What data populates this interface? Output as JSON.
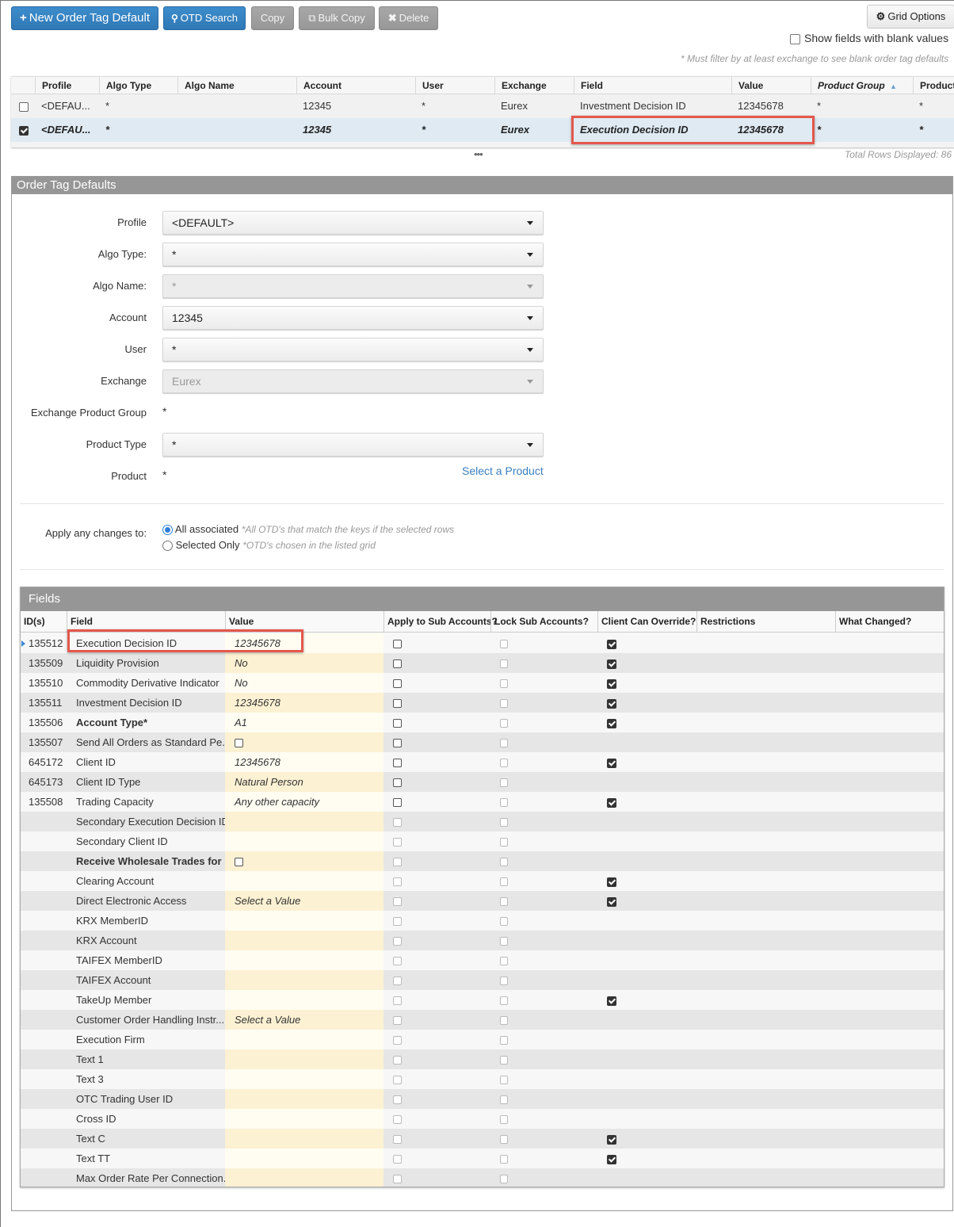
{
  "toolbar": {
    "new_label": "New Order Tag Default",
    "search_label": "OTD Search",
    "copy_label": "Copy",
    "bulk_copy_label": "Bulk Copy",
    "delete_label": "Delete",
    "grid_options_label": "Grid Options",
    "show_blank_label": "Show fields with blank values",
    "filter_note": "* Must filter by at least exchange to see blank order tag defaults"
  },
  "top_grid": {
    "columns": [
      "Profile",
      "Algo Type",
      "Algo Name",
      "Account",
      "User",
      "Exchange",
      "Field",
      "Value",
      "Product Group",
      "Product"
    ],
    "sorted_column": "Product Group",
    "sort_direction": "ascending",
    "rows": [
      {
        "selected": false,
        "profile": "<DEFAU...",
        "algo_type": "*",
        "algo_name": "",
        "account": "12345",
        "user": "*",
        "exchange": "Eurex",
        "field": "Investment Decision ID",
        "value": "12345678",
        "product_group": "*",
        "product": "*"
      },
      {
        "selected": true,
        "profile": "<DEFAU...",
        "algo_type": "*",
        "algo_name": "",
        "account": "12345",
        "user": "*",
        "exchange": "Eurex",
        "field": "Execution Decision ID",
        "value": "12345678",
        "product_group": "*",
        "product": "*"
      }
    ],
    "more_label": "•••",
    "total_rows": "Total Rows Displayed: 86"
  },
  "panel": {
    "title": "Order Tag Defaults",
    "form": {
      "profile": {
        "label": "Profile",
        "value": "<DEFAULT>"
      },
      "algo_type": {
        "label": "Algo Type:",
        "value": "*"
      },
      "algo_name": {
        "label": "Algo Name:",
        "value": "*"
      },
      "account": {
        "label": "Account",
        "value": "12345"
      },
      "user": {
        "label": "User",
        "value": "*"
      },
      "exchange": {
        "label": "Exchange",
        "value": "Eurex"
      },
      "exchange_product_group": {
        "label": "Exchange Product Group",
        "value": "*"
      },
      "product_type": {
        "label": "Product Type",
        "value": "*"
      },
      "product": {
        "label": "Product",
        "value": "*",
        "link": "Select a Product"
      }
    },
    "apply": {
      "label": "Apply any changes to:",
      "options": [
        {
          "label": "All associated",
          "hint": "*All OTD's that match the keys if the selected rows",
          "selected": true
        },
        {
          "label": "Selected Only",
          "hint": "*OTD's chosen in the listed grid",
          "selected": false
        }
      ]
    }
  },
  "fields": {
    "title": "Fields",
    "columns": [
      "ID(s)",
      "Field",
      "Value",
      "Apply to Sub Accounts?",
      "Lock Sub Accounts?",
      "Client Can Override?",
      "Restrictions",
      "What Changed?"
    ],
    "rows": [
      {
        "id": "135512",
        "field": "Execution Decision ID",
        "value": "12345678",
        "bold": false,
        "apply": false,
        "apply_enabled": true,
        "lock": false,
        "override": true,
        "current": true
      },
      {
        "id": "135509",
        "field": "Liquidity Provision",
        "value": "No",
        "bold": false,
        "apply": false,
        "apply_enabled": true,
        "lock": false,
        "override": true
      },
      {
        "id": "135510",
        "field": "Commodity Derivative Indicator",
        "value": "No",
        "bold": false,
        "apply": false,
        "apply_enabled": true,
        "lock": false,
        "override": true
      },
      {
        "id": "135511",
        "field": "Investment Decision ID",
        "value": "12345678",
        "bold": false,
        "apply": false,
        "apply_enabled": true,
        "lock": false,
        "override": true
      },
      {
        "id": "135506",
        "field": "Account Type*",
        "value": "A1",
        "bold": true,
        "apply": false,
        "apply_enabled": true,
        "lock": false,
        "override": true
      },
      {
        "id": "135507",
        "field": "Send All Orders as Standard Pe...",
        "value_checkbox": false,
        "bold": false,
        "apply": false,
        "apply_enabled": true,
        "lock": false,
        "override": false
      },
      {
        "id": "645172",
        "field": "Client ID",
        "value": "12345678",
        "bold": false,
        "apply": false,
        "apply_enabled": true,
        "lock": false,
        "override": true
      },
      {
        "id": "645173",
        "field": "Client ID Type",
        "value": "Natural Person",
        "bold": false,
        "apply": false,
        "apply_enabled": true,
        "lock": false,
        "override": false
      },
      {
        "id": "135508",
        "field": "Trading Capacity",
        "value": "Any other capacity",
        "bold": false,
        "apply": false,
        "apply_enabled": true,
        "lock": false,
        "override": true
      },
      {
        "id": "",
        "field": "Secondary Execution Decision ID",
        "value": "",
        "bold": false,
        "apply": false,
        "apply_enabled": false,
        "lock": false,
        "override": false
      },
      {
        "id": "",
        "field": "Secondary Client ID",
        "value": "",
        "bold": false,
        "apply": false,
        "apply_enabled": false,
        "lock": false,
        "override": false
      },
      {
        "id": "",
        "field": "Receive Wholesale Trades for ...",
        "value_checkbox": false,
        "bold": true,
        "apply": false,
        "apply_enabled": false,
        "lock": false,
        "override": false
      },
      {
        "id": "",
        "field": "Clearing Account",
        "value": "",
        "bold": false,
        "apply": false,
        "apply_enabled": false,
        "lock": false,
        "override": true
      },
      {
        "id": "",
        "field": "Direct Electronic Access",
        "value": "Select a Value",
        "bold": false,
        "apply": false,
        "apply_enabled": false,
        "lock": false,
        "override": true
      },
      {
        "id": "",
        "field": "KRX MemberID",
        "value": "",
        "bold": false,
        "apply": false,
        "apply_enabled": false,
        "lock": false,
        "override": false
      },
      {
        "id": "",
        "field": "KRX Account",
        "value": "",
        "bold": false,
        "apply": false,
        "apply_enabled": false,
        "lock": false,
        "override": false
      },
      {
        "id": "",
        "field": "TAIFEX MemberID",
        "value": "",
        "bold": false,
        "apply": false,
        "apply_enabled": false,
        "lock": false,
        "override": false
      },
      {
        "id": "",
        "field": "TAIFEX Account",
        "value": "",
        "bold": false,
        "apply": false,
        "apply_enabled": false,
        "lock": false,
        "override": false
      },
      {
        "id": "",
        "field": "TakeUp Member",
        "value": "",
        "bold": false,
        "apply": false,
        "apply_enabled": false,
        "lock": false,
        "override": true
      },
      {
        "id": "",
        "field": "Customer Order Handling Instr...",
        "value": "Select a Value",
        "bold": false,
        "apply": false,
        "apply_enabled": false,
        "lock": false,
        "override": false
      },
      {
        "id": "",
        "field": "Execution Firm",
        "value": "",
        "bold": false,
        "apply": false,
        "apply_enabled": false,
        "lock": false,
        "override": false
      },
      {
        "id": "",
        "field": "Text 1",
        "value": "",
        "bold": false,
        "apply": false,
        "apply_enabled": false,
        "lock": false,
        "override": false
      },
      {
        "id": "",
        "field": "Text 3",
        "value": "",
        "bold": false,
        "apply": false,
        "apply_enabled": false,
        "lock": false,
        "override": false
      },
      {
        "id": "",
        "field": "OTC Trading User ID",
        "value": "",
        "bold": false,
        "apply": false,
        "apply_enabled": false,
        "lock": false,
        "override": false
      },
      {
        "id": "",
        "field": "Cross ID",
        "value": "",
        "bold": false,
        "apply": false,
        "apply_enabled": false,
        "lock": false,
        "override": false
      },
      {
        "id": "",
        "field": "Text C",
        "value": "",
        "bold": false,
        "apply": false,
        "apply_enabled": false,
        "lock": false,
        "override": true
      },
      {
        "id": "",
        "field": "Text TT",
        "value": "",
        "bold": false,
        "apply": false,
        "apply_enabled": false,
        "lock": false,
        "override": true
      },
      {
        "id": "",
        "field": "Max Order Rate Per Connection...",
        "value": "",
        "bold": false,
        "apply": false,
        "apply_enabled": false,
        "lock": false,
        "override": false
      }
    ]
  },
  "colors": {
    "primary_button": "#2f78b5",
    "secondary_button": "#979797",
    "highlight_box": "#e4574c",
    "selected_row": "#dfeaf2",
    "panel_header": "#969696",
    "link": "#3a7fc1",
    "radio_selected": "#2f7fd8"
  }
}
